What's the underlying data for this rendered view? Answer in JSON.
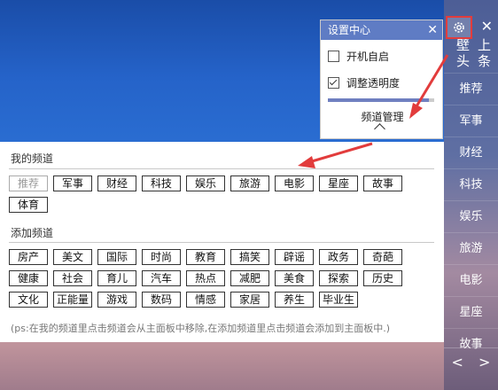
{
  "sidebar": {
    "close_label": "✕",
    "logo": [
      "壁",
      "上",
      "头",
      "条"
    ],
    "items": [
      "推荐",
      "军事",
      "财经",
      "科技",
      "娱乐",
      "旅游",
      "电影",
      "星座",
      "故事"
    ],
    "prev_label": "<",
    "next_label": ">"
  },
  "settings": {
    "title": "设置中心",
    "close_label": "✕",
    "options": [
      {
        "label": "开机自启",
        "checked": false
      },
      {
        "label": "调整透明度",
        "checked": true
      }
    ],
    "opacity_value": 0.95,
    "manage_label": "频道管理"
  },
  "my_channels": {
    "title": "我的频道",
    "tags": [
      "推荐",
      "军事",
      "财经",
      "科技",
      "娱乐",
      "旅游",
      "电影",
      "星座",
      "故事",
      "体育"
    ]
  },
  "add_channels": {
    "title": "添加频道",
    "tags": [
      "房产",
      "美文",
      "国际",
      "时尚",
      "教育",
      "搞笑",
      "辟谣",
      "政务",
      "奇葩",
      "健康",
      "社会",
      "育儿",
      "汽车",
      "热点",
      "减肥",
      "美食",
      "探索",
      "历史",
      "文化",
      "正能量",
      "游戏",
      "数码",
      "情感",
      "家居",
      "养生",
      "毕业生"
    ]
  },
  "hint": "(ps:在我的频道里点击频道会从主面板中移除,在添加频道里点击频道会添加到主面板中.)",
  "colors": {
    "header": "#5f7cc4",
    "highlight": "#e23c3c"
  }
}
